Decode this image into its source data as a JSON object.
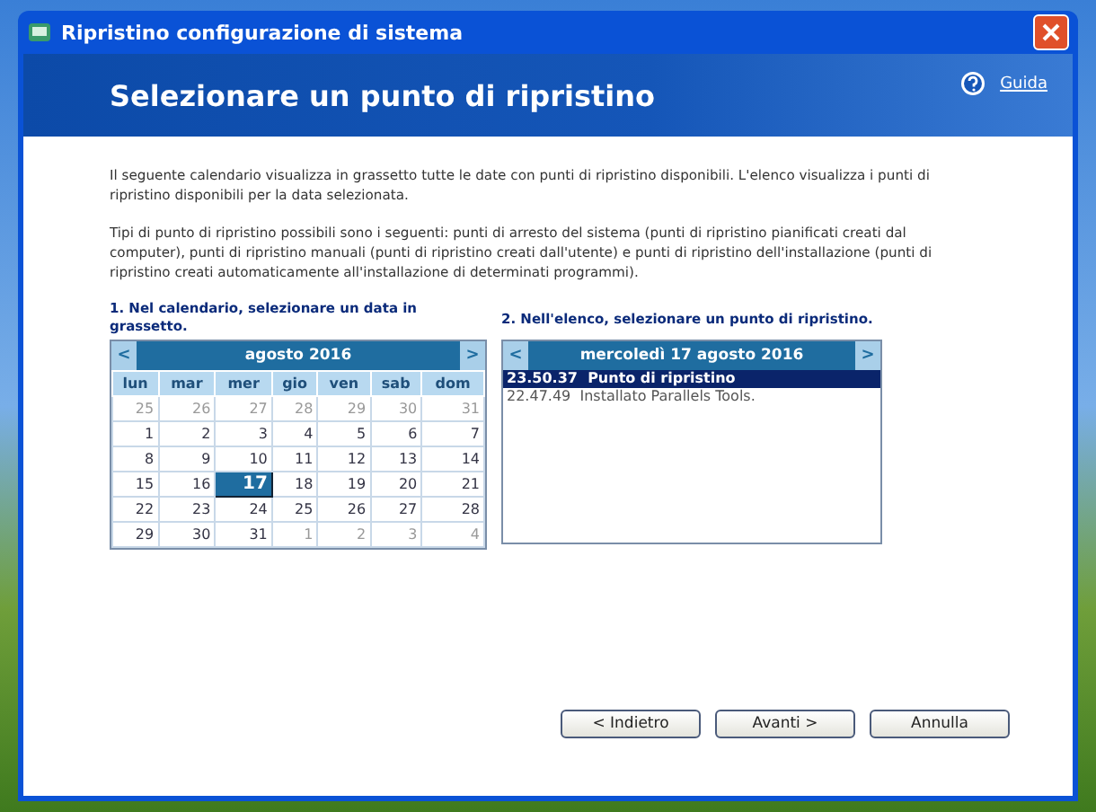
{
  "window": {
    "title": "Ripristino configurazione di sistema"
  },
  "header": {
    "title": "Selezionare un punto di ripristino",
    "help_link": "Guida"
  },
  "intro": [
    "Il seguente calendario visualizza in grassetto tutte le date con punti di ripristino disponibili. L'elenco visualizza i punti di ripristino disponibili per la data selezionata.",
    "Tipi di punto di ripristino possibili sono i seguenti: punti di arresto del sistema (punti di ripristino pianificati creati dal computer), punti di ripristino manuali (punti di ripristino creati dall'utente) e punti di ripristino dell'installazione (punti di ripristino creati automaticamente all'installazione di determinati programmi)."
  ],
  "calendar": {
    "instruction": "1. Nel calendario, selezionare un data in grassetto.",
    "prev": "<",
    "next": ">",
    "month": "agosto 2016",
    "weekdays": [
      "lun",
      "mar",
      "mer",
      "gio",
      "ven",
      "sab",
      "dom"
    ],
    "weeks": [
      [
        {
          "label": "25",
          "other_month": true,
          "selected": false
        },
        {
          "label": "26",
          "other_month": true,
          "selected": false
        },
        {
          "label": "27",
          "other_month": true,
          "selected": false
        },
        {
          "label": "28",
          "other_month": true,
          "selected": false
        },
        {
          "label": "29",
          "other_month": true,
          "selected": false
        },
        {
          "label": "30",
          "other_month": true,
          "selected": false
        },
        {
          "label": "31",
          "other_month": true,
          "selected": false
        }
      ],
      [
        {
          "label": "1",
          "other_month": false,
          "selected": false
        },
        {
          "label": "2",
          "other_month": false,
          "selected": false
        },
        {
          "label": "3",
          "other_month": false,
          "selected": false
        },
        {
          "label": "4",
          "other_month": false,
          "selected": false
        },
        {
          "label": "5",
          "other_month": false,
          "selected": false
        },
        {
          "label": "6",
          "other_month": false,
          "selected": false
        },
        {
          "label": "7",
          "other_month": false,
          "selected": false
        }
      ],
      [
        {
          "label": "8",
          "other_month": false,
          "selected": false
        },
        {
          "label": "9",
          "other_month": false,
          "selected": false
        },
        {
          "label": "10",
          "other_month": false,
          "selected": false
        },
        {
          "label": "11",
          "other_month": false,
          "selected": false
        },
        {
          "label": "12",
          "other_month": false,
          "selected": false
        },
        {
          "label": "13",
          "other_month": false,
          "selected": false
        },
        {
          "label": "14",
          "other_month": false,
          "selected": false
        }
      ],
      [
        {
          "label": "15",
          "other_month": false,
          "selected": false
        },
        {
          "label": "16",
          "other_month": false,
          "selected": false
        },
        {
          "label": "17",
          "other_month": false,
          "selected": true
        },
        {
          "label": "18",
          "other_month": false,
          "selected": false
        },
        {
          "label": "19",
          "other_month": false,
          "selected": false
        },
        {
          "label": "20",
          "other_month": false,
          "selected": false
        },
        {
          "label": "21",
          "other_month": false,
          "selected": false
        }
      ],
      [
        {
          "label": "22",
          "other_month": false,
          "selected": false
        },
        {
          "label": "23",
          "other_month": false,
          "selected": false
        },
        {
          "label": "24",
          "other_month": false,
          "selected": false
        },
        {
          "label": "25",
          "other_month": false,
          "selected": false
        },
        {
          "label": "26",
          "other_month": false,
          "selected": false
        },
        {
          "label": "27",
          "other_month": false,
          "selected": false
        },
        {
          "label": "28",
          "other_month": false,
          "selected": false
        }
      ],
      [
        {
          "label": "29",
          "other_month": false,
          "selected": false
        },
        {
          "label": "30",
          "other_month": false,
          "selected": false
        },
        {
          "label": "31",
          "other_month": false,
          "selected": false
        },
        {
          "label": "1",
          "other_month": true,
          "selected": false
        },
        {
          "label": "2",
          "other_month": true,
          "selected": false
        },
        {
          "label": "3",
          "other_month": true,
          "selected": false
        },
        {
          "label": "4",
          "other_month": true,
          "selected": false
        }
      ]
    ]
  },
  "restore_points": {
    "instruction": "2. Nell'elenco, selezionare un punto di ripristino.",
    "prev": "<",
    "next": ">",
    "date": "mercoledì 17 agosto 2016",
    "items": [
      {
        "time": "23.50.37",
        "description": "Punto di ripristino",
        "selected": true
      },
      {
        "time": "22.47.49",
        "description": "Installato Parallels Tools.",
        "selected": false
      }
    ]
  },
  "buttons": [
    {
      "label": "< Indietro"
    },
    {
      "label": "Avanti >"
    },
    {
      "label": "Annulla"
    }
  ]
}
